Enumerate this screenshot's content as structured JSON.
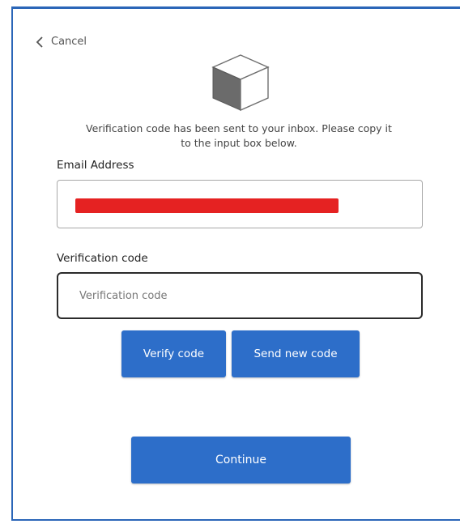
{
  "header": {
    "cancel_label": "Cancel",
    "back_icon": "chevron-left-icon",
    "logo_icon": "cube-icon"
  },
  "message": {
    "line1": "Verification code has been sent to your inbox. Please copy it",
    "line2": "to the input box below."
  },
  "email": {
    "label": "Email Address",
    "value_redacted": true
  },
  "verification": {
    "label": "Verification code",
    "placeholder": "Verification code",
    "value": ""
  },
  "buttons": {
    "verify_label": "Verify code",
    "send_new_label": "Send new code",
    "continue_label": "Continue"
  },
  "colors": {
    "accent": "#2d6ec9",
    "frame": "#2b66b8",
    "redaction": "#e52222"
  }
}
